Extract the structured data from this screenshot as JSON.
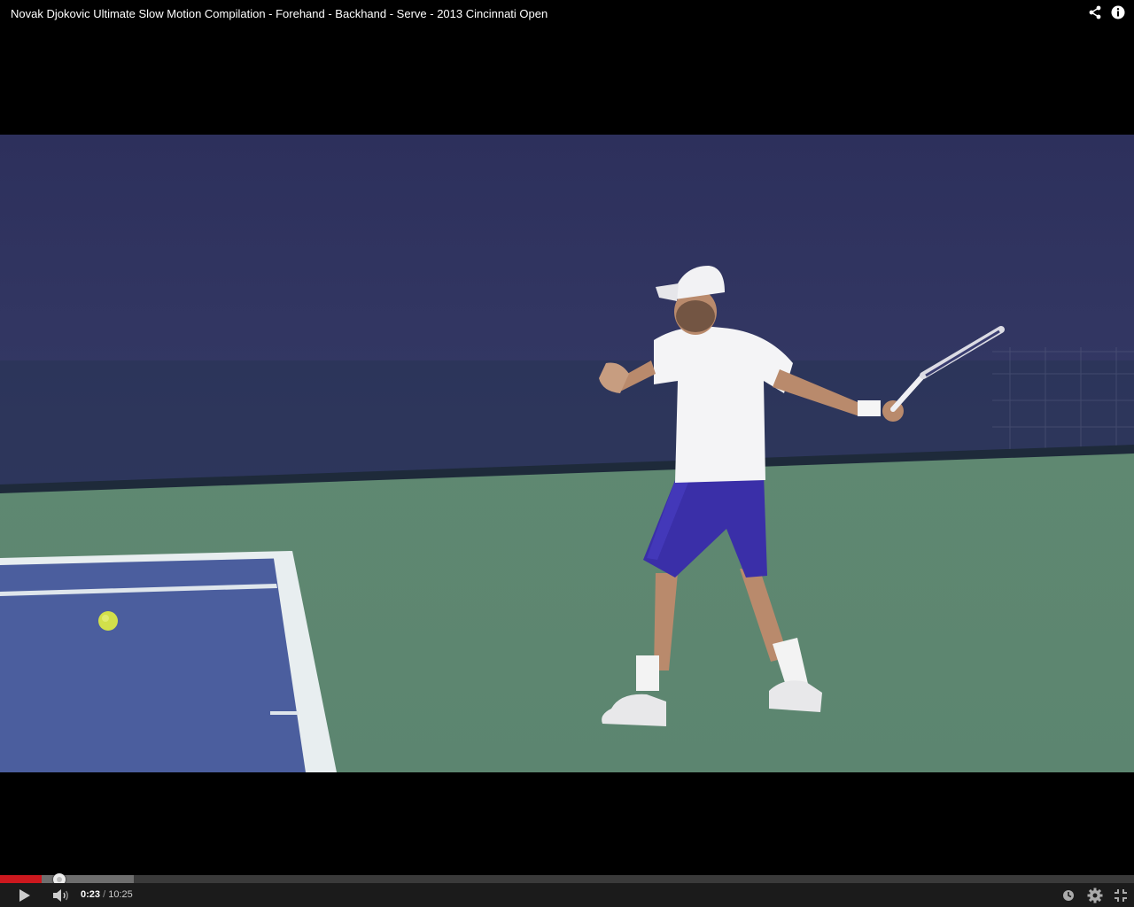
{
  "video": {
    "title": "Novak Djokovic Ultimate Slow Motion Compilation - Forehand - Backhand - Serve - 2013 Cincinnati Open"
  },
  "title_icons": [
    "share-icon",
    "info-icon"
  ],
  "playback": {
    "current_time": "0:23",
    "separator": " / ",
    "duration": "10:25",
    "played_fraction": 0.0368,
    "buffered_fraction": 0.118
  },
  "controls": [
    "play-icon",
    "volume-icon",
    "watch-later-icon",
    "settings-icon",
    "fullscreen-icon"
  ],
  "colors": {
    "progress_played": "#cc181e",
    "progress_buffered": "#6e6e6e",
    "control_bar": "#1b1b1b",
    "background": "#000000"
  }
}
